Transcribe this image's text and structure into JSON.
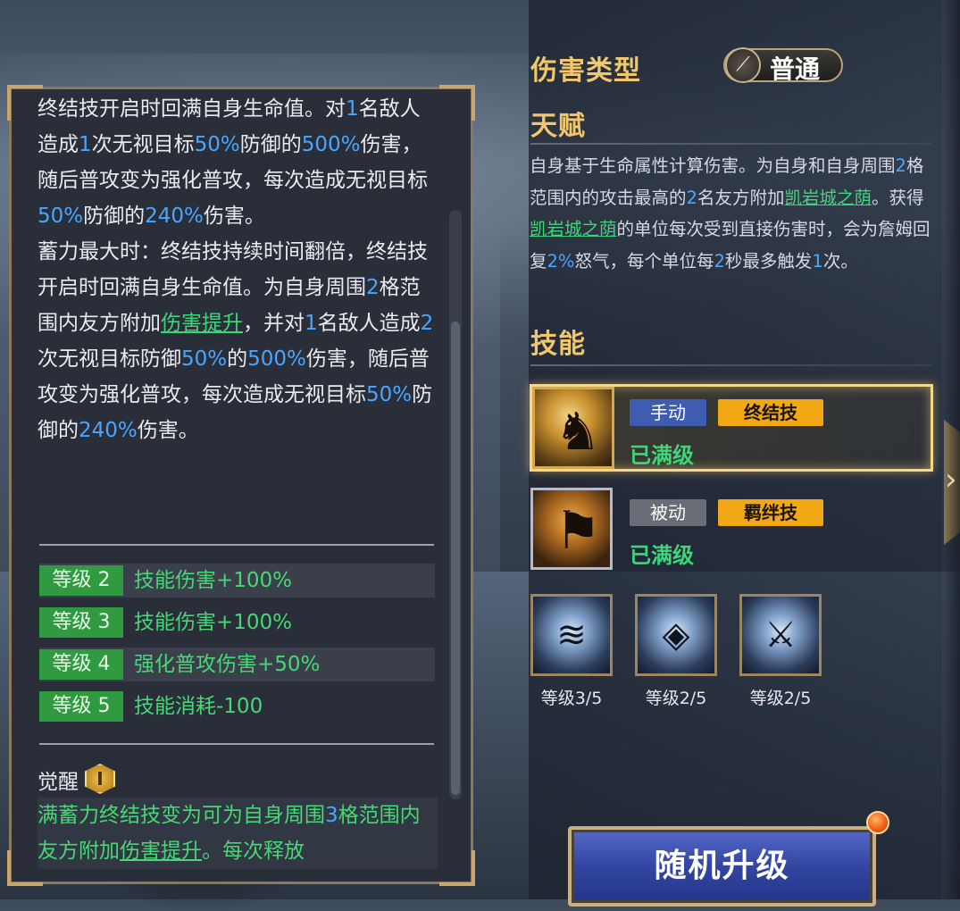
{
  "tooltip": {
    "description": [
      {
        "t": "终结技开启时回满自身生命值。对"
      },
      {
        "t": "1",
        "c": "blue"
      },
      {
        "t": "名敌人造成"
      },
      {
        "t": "1",
        "c": "blue"
      },
      {
        "t": "次无视目标"
      },
      {
        "t": "50%",
        "c": "blue"
      },
      {
        "t": "防御的"
      },
      {
        "t": "500%",
        "c": "blue"
      },
      {
        "t": "伤害，随后普攻变为强化普攻，每次造成无视目标"
      },
      {
        "t": "50%",
        "c": "blue"
      },
      {
        "t": "防御的"
      },
      {
        "t": "240%",
        "c": "blue"
      },
      {
        "t": "伤害。"
      },
      {
        "br": true
      },
      {
        "t": "蓄力最大时：终结技持续时间翻倍，终结技开启时回满自身生命值。为自身周围"
      },
      {
        "t": "2",
        "c": "blue"
      },
      {
        "t": "格范围内友方附加"
      },
      {
        "t": "伤害提升",
        "c": "link"
      },
      {
        "t": "，并对"
      },
      {
        "t": "1",
        "c": "blue"
      },
      {
        "t": "名敌人造成"
      },
      {
        "t": "2",
        "c": "blue"
      },
      {
        "t": "次无视目标防御"
      },
      {
        "t": "50%",
        "c": "blue"
      },
      {
        "t": "的"
      },
      {
        "t": "500%",
        "c": "blue"
      },
      {
        "t": "伤害，随后普攻变为强化普攻，每次造成无视目标"
      },
      {
        "t": "50%",
        "c": "blue"
      },
      {
        "t": "防御的"
      },
      {
        "t": "240%",
        "c": "blue"
      },
      {
        "t": "伤害。"
      }
    ],
    "levels": [
      {
        "badge": "等级 2",
        "text": "技能伤害+100%"
      },
      {
        "badge": "等级 3",
        "text": "技能伤害+100%"
      },
      {
        "badge": "等级 4",
        "text": "强化普攻伤害+50%"
      },
      {
        "badge": "等级 5",
        "text": "技能消耗-100"
      }
    ],
    "awaken_label": "觉醒",
    "awaken_icon_text": "I",
    "awaken_text": [
      {
        "t": "满蓄力终结技变为可为自身周围"
      },
      {
        "t": "3",
        "c": "blue"
      },
      {
        "t": "格范围内友方附加"
      },
      {
        "t": "伤害提升",
        "c": "link"
      },
      {
        "t": "。每次释放"
      }
    ]
  },
  "damage_type": {
    "title": "伤害类型",
    "value": "普通",
    "icon": "feather-blade-icon"
  },
  "talent": {
    "title": "天赋",
    "text": [
      {
        "t": "自身基于生命属性计算伤害。为自身和自身周围"
      },
      {
        "t": "2",
        "c": "blue"
      },
      {
        "t": "格范围内的攻击最高的"
      },
      {
        "t": "2",
        "c": "blue"
      },
      {
        "t": "名友方附加"
      },
      {
        "t": "凯岩城之荫",
        "c": "link"
      },
      {
        "t": "。获得"
      },
      {
        "t": "凯岩城之荫",
        "c": "link"
      },
      {
        "t": "的单位每次受到直接伤害时，会为詹姆回复"
      },
      {
        "t": "2%",
        "c": "blue"
      },
      {
        "t": "怒气，每个单位每"
      },
      {
        "t": "2",
        "c": "blue"
      },
      {
        "t": "秒最多触发"
      },
      {
        "t": "1",
        "c": "blue"
      },
      {
        "t": "次。"
      }
    ]
  },
  "skills": {
    "title": "技能",
    "list": [
      {
        "tag1": "手动",
        "tag2": "终结技",
        "status": "已满级",
        "icon": "knight-banner-icon"
      },
      {
        "tag1": "被动",
        "tag2": "羁绊技",
        "status": "已满级",
        "icon": "war-flag-icon"
      }
    ],
    "minis": [
      {
        "label": "等级3/5",
        "icon": "wind-slash-icon"
      },
      {
        "label": "等级2/5",
        "icon": "shield-swirl-icon"
      },
      {
        "label": "等级2/5",
        "icon": "sword-strike-icon"
      }
    ]
  },
  "upgrade_button": {
    "label": "随机升级"
  },
  "colors": {
    "accent_gold": "#f2c66a",
    "green": "#3fd67a",
    "blue": "#49a6ff",
    "tag_orange": "#f2a814",
    "tag_blue": "#3e5db0"
  }
}
